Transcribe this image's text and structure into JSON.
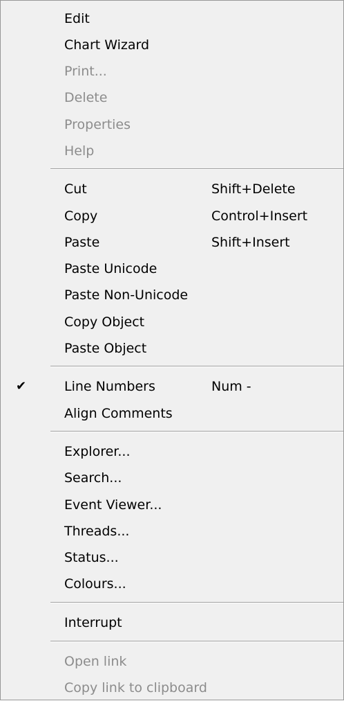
{
  "menu": {
    "items": [
      {
        "label": "Edit",
        "shortcut": "",
        "enabled": true,
        "checked": false
      },
      {
        "label": "Chart Wizard",
        "shortcut": "",
        "enabled": true,
        "checked": false
      },
      {
        "label": "Print...",
        "shortcut": "",
        "enabled": false,
        "checked": false
      },
      {
        "label": "Delete",
        "shortcut": "",
        "enabled": false,
        "checked": false
      },
      {
        "label": "Properties",
        "shortcut": "",
        "enabled": false,
        "checked": false
      },
      {
        "label": "Help",
        "shortcut": "",
        "enabled": false,
        "checked": false
      },
      {
        "label": "Cut",
        "shortcut": "Shift+Delete",
        "enabled": true,
        "checked": false
      },
      {
        "label": "Copy",
        "shortcut": "Control+Insert",
        "enabled": true,
        "checked": false
      },
      {
        "label": "Paste",
        "shortcut": "Shift+Insert",
        "enabled": true,
        "checked": false
      },
      {
        "label": "Paste Unicode",
        "shortcut": "",
        "enabled": true,
        "checked": false
      },
      {
        "label": "Paste Non-Unicode",
        "shortcut": "",
        "enabled": true,
        "checked": false
      },
      {
        "label": "Copy Object",
        "shortcut": "",
        "enabled": true,
        "checked": false
      },
      {
        "label": "Paste Object",
        "shortcut": "",
        "enabled": true,
        "checked": false
      },
      {
        "label": "Line Numbers",
        "shortcut": "Num -",
        "enabled": true,
        "checked": true
      },
      {
        "label": "Align Comments",
        "shortcut": "",
        "enabled": true,
        "checked": false
      },
      {
        "label": "Explorer...",
        "shortcut": "",
        "enabled": true,
        "checked": false
      },
      {
        "label": "Search...",
        "shortcut": "",
        "enabled": true,
        "checked": false
      },
      {
        "label": "Event Viewer...",
        "shortcut": "",
        "enabled": true,
        "checked": false
      },
      {
        "label": "Threads...",
        "shortcut": "",
        "enabled": true,
        "checked": false
      },
      {
        "label": "Status...",
        "shortcut": "",
        "enabled": true,
        "checked": false
      },
      {
        "label": "Colours...",
        "shortcut": "",
        "enabled": true,
        "checked": false
      },
      {
        "label": "Interrupt",
        "shortcut": "",
        "enabled": true,
        "checked": false
      },
      {
        "label": "Open link",
        "shortcut": "",
        "enabled": false,
        "checked": false
      },
      {
        "label": "Copy link to clipboard",
        "shortcut": "",
        "enabled": false,
        "checked": false
      }
    ],
    "check_glyph": "✔",
    "colors": {
      "background": "#f0f0f0",
      "text": "#000000",
      "disabled_text": "#8c8c8c",
      "border": "#979797",
      "separator": "#a0a0a0"
    }
  }
}
